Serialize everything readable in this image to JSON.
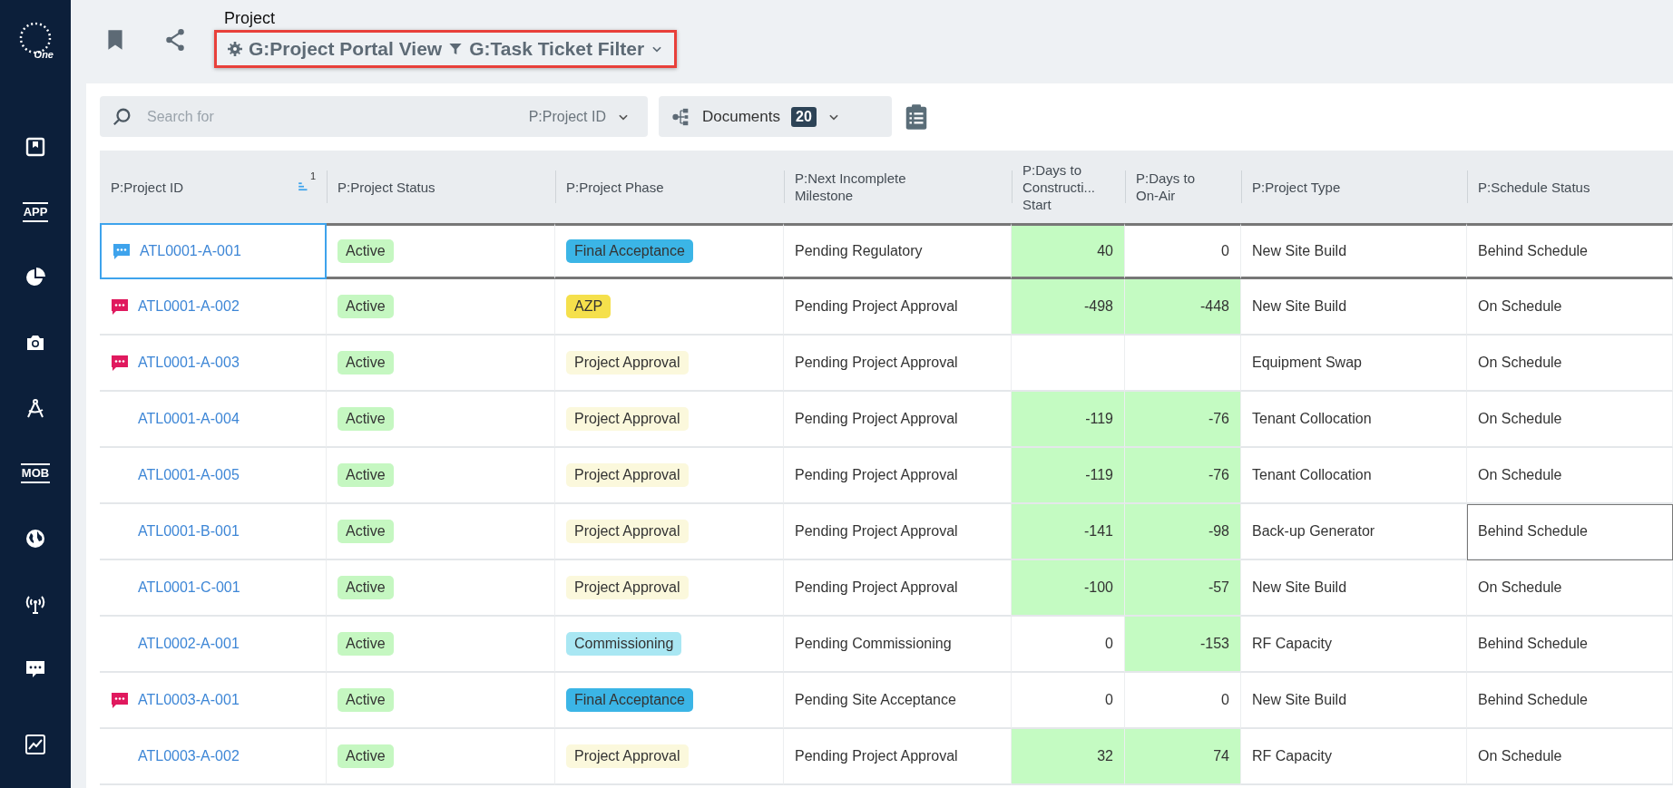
{
  "sidebar": {
    "logo": "One",
    "items": [
      {
        "kind": "icon"
      },
      {
        "kind": "label",
        "label": "APP"
      },
      {
        "kind": "icon"
      },
      {
        "kind": "icon"
      },
      {
        "kind": "icon"
      },
      {
        "kind": "label",
        "label": "MOB"
      },
      {
        "kind": "icon"
      },
      {
        "kind": "icon"
      },
      {
        "kind": "icon"
      },
      {
        "kind": "icon"
      }
    ]
  },
  "header": {
    "title": "Project",
    "view": "G:Project Portal View",
    "filter": "G:Task Ticket Filter"
  },
  "toolbar": {
    "search": {
      "placeholder": "Search for",
      "field": "P:Project ID"
    },
    "documents": {
      "label": "Documents",
      "count": "20"
    }
  },
  "table": {
    "columns": [
      {
        "lines": [
          "P:Project ID"
        ],
        "sort": "1"
      },
      {
        "lines": [
          "P:Project Status"
        ]
      },
      {
        "lines": [
          "P:Project Phase"
        ]
      },
      {
        "lines": [
          "P:Next Incomplete",
          "Milestone"
        ]
      },
      {
        "lines": [
          "P:Days to",
          "Constructi...",
          "Start"
        ]
      },
      {
        "lines": [
          "P:Days to",
          "On-Air"
        ]
      },
      {
        "lines": [
          "P:Project Type"
        ]
      },
      {
        "lines": [
          "P:Schedule Status"
        ]
      }
    ],
    "rows": [
      {
        "id": "ATL0001-A-001",
        "selected": true,
        "comment": {
          "color": "#3ea3ec"
        },
        "status": "Active",
        "phase": {
          "label": "Final Acceptance",
          "color": "#3bb5e6"
        },
        "milestone": "Pending Regulatory",
        "construction": "40",
        "construction_green": true,
        "on_air": "0",
        "on_air_green": false,
        "type": "New Site Build",
        "schedule": "Behind Schedule",
        "schedule_outlined": false
      },
      {
        "id": "ATL0001-A-002",
        "selected": false,
        "comment": {
          "color": "#e0195e"
        },
        "status": "Active",
        "phase": {
          "label": "AZP",
          "color": "#f5e04c"
        },
        "milestone": "Pending Project Approval",
        "construction": "-498",
        "construction_green": true,
        "on_air": "-448",
        "on_air_green": true,
        "type": "New Site Build",
        "schedule": "On Schedule",
        "schedule_outlined": false
      },
      {
        "id": "ATL0001-A-003",
        "selected": false,
        "comment": {
          "color": "#e0195e"
        },
        "status": "Active",
        "phase": {
          "label": "Project Approval",
          "color": "#fbf8dc"
        },
        "milestone": "Pending Project Approval",
        "construction_green": false,
        "on_air_green": false,
        "type": "Equipment Swap",
        "schedule": "On Schedule",
        "schedule_outlined": false
      },
      {
        "id": "ATL0001-A-004",
        "selected": false,
        "status": "Active",
        "phase": {
          "label": "Project Approval",
          "color": "#fbf8dc"
        },
        "milestone": "Pending Project Approval",
        "construction": "-119",
        "construction_green": true,
        "on_air": "-76",
        "on_air_green": true,
        "type": "Tenant Collocation",
        "schedule": "On Schedule",
        "schedule_outlined": false
      },
      {
        "id": "ATL0001-A-005",
        "selected": false,
        "status": "Active",
        "phase": {
          "label": "Project Approval",
          "color": "#fbf8dc"
        },
        "milestone": "Pending Project Approval",
        "construction": "-119",
        "construction_green": true,
        "on_air": "-76",
        "on_air_green": true,
        "type": "Tenant Collocation",
        "schedule": "On Schedule",
        "schedule_outlined": false
      },
      {
        "id": "ATL0001-B-001",
        "selected": false,
        "status": "Active",
        "phase": {
          "label": "Project Approval",
          "color": "#fbf8dc"
        },
        "milestone": "Pending Project Approval",
        "construction": "-141",
        "construction_green": true,
        "on_air": "-98",
        "on_air_green": true,
        "type": "Back-up Generator",
        "schedule": "Behind Schedule",
        "schedule_outlined": true
      },
      {
        "id": "ATL0001-C-001",
        "selected": false,
        "status": "Active",
        "phase": {
          "label": "Project Approval",
          "color": "#fbf8dc"
        },
        "milestone": "Pending Project Approval",
        "construction": "-100",
        "construction_green": true,
        "on_air": "-57",
        "on_air_green": true,
        "type": "New Site Build",
        "schedule": "On Schedule",
        "schedule_outlined": false
      },
      {
        "id": "ATL0002-A-001",
        "selected": false,
        "status": "Active",
        "phase": {
          "label": "Commissioning",
          "color": "#a9e7f3"
        },
        "milestone": "Pending Commissioning",
        "construction": "0",
        "construction_green": false,
        "on_air": "-153",
        "on_air_green": true,
        "type": "RF Capacity",
        "schedule": "Behind Schedule",
        "schedule_outlined": false
      },
      {
        "id": "ATL0003-A-001",
        "selected": false,
        "comment": {
          "color": "#e0195e"
        },
        "status": "Active",
        "phase": {
          "label": "Final Acceptance",
          "color": "#3bb5e6"
        },
        "milestone": "Pending Site Acceptance",
        "construction": "0",
        "construction_green": false,
        "on_air": "0",
        "on_air_green": false,
        "type": "New Site Build",
        "schedule": "Behind Schedule",
        "schedule_outlined": false
      },
      {
        "id": "ATL0003-A-002",
        "selected": false,
        "status": "Active",
        "phase": {
          "label": "Project Approval",
          "color": "#fbf8dc"
        },
        "milestone": "Pending Project Approval",
        "construction": "32",
        "construction_green": true,
        "on_air": "74",
        "on_air_green": true,
        "type": "RF Capacity",
        "schedule": "On Schedule",
        "schedule_outlined": false
      }
    ]
  }
}
